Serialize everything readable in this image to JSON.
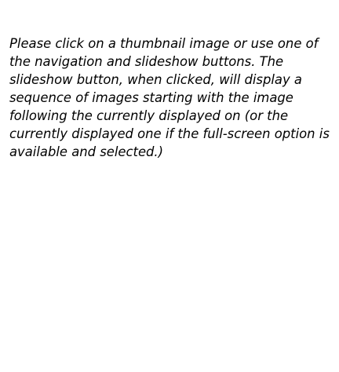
{
  "instructions": {
    "text": "Please click on a thumbnail image or use one of the navigation and slideshow buttons. The slideshow button, when clicked, will display a sequence of images starting with the image following the currently displayed on (or the currently displayed one if the full-screen option is available and selected.)"
  }
}
